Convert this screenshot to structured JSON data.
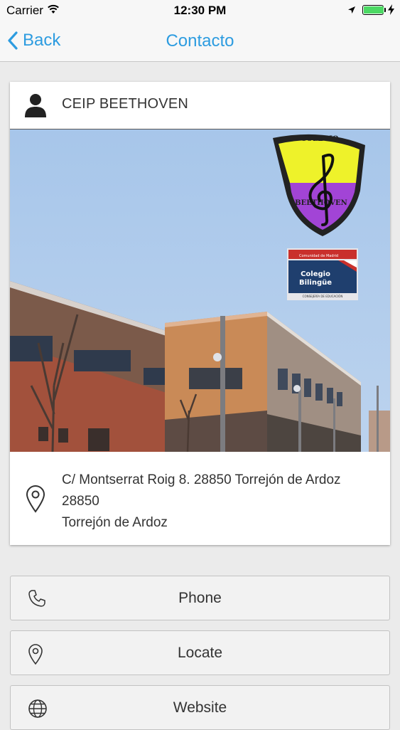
{
  "status_bar": {
    "carrier": "Carrier",
    "time": "12:30 PM",
    "battery_level": 1.0,
    "battery_color": "#4cd964"
  },
  "nav": {
    "back_label": "Back",
    "title": "Contacto",
    "accent_color": "#2d9ce0"
  },
  "card": {
    "title": "CEIP BEETHOVEN",
    "header_icon": "user-icon",
    "photo": {
      "crest_top": "COLEGIO",
      "crest_bottom": "BEETHOVEN",
      "badge_top": "Comunidad de Madrid",
      "badge_line1": "Colegio",
      "badge_line2": "Bilingüe",
      "badge_bottom": "CONSEJERÍA DE EDUCACIÓN"
    },
    "address": {
      "icon": "map-pin-icon",
      "line1": "C/ Montserrat Roig 8. 28850 Torrejón de Ardoz",
      "line2": "28850",
      "line3": "Torrejón de Ardoz"
    }
  },
  "actions": {
    "phone": {
      "label": "Phone",
      "icon": "phone-icon"
    },
    "locate": {
      "label": "Locate",
      "icon": "map-pin-icon"
    },
    "website": {
      "label": "Website",
      "icon": "globe-icon"
    }
  }
}
